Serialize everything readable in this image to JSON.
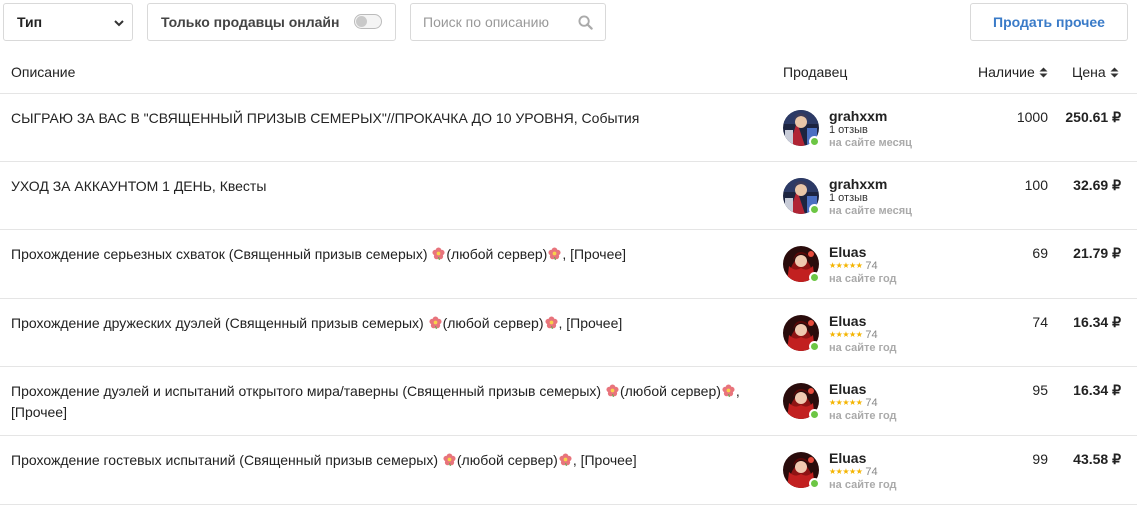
{
  "filters": {
    "type_label": "Тип",
    "online_label": "Только продавцы онлайн",
    "online_enabled": false,
    "search_placeholder": "Поиск по описанию",
    "search_value": "",
    "sell_label": "Продать прочее"
  },
  "table": {
    "headers": {
      "description": "Описание",
      "seller": "Продавец",
      "availability": "Наличие",
      "price": "Цена"
    },
    "rows": [
      {
        "desc_parts": [
          "СЫГРАЮ ЗА ВАС В \"СВЯЩЕННЫЙ ПРИЗЫВ СЕМЕРЫХ\"//ПРОКАЧКА ДО 10 УРОВНЯ, События"
        ],
        "seller": "grahxxm",
        "reviews": "1 отзыв",
        "stars": "",
        "rating_count": "",
        "since": "на сайте месяц",
        "availability": "1000",
        "price": "250.61 ₽"
      },
      {
        "desc_parts": [
          "УХОД ЗА АККАУНТОМ 1 ДЕНЬ, Квесты"
        ],
        "seller": "grahxxm",
        "reviews": "1 отзыв",
        "stars": "",
        "rating_count": "",
        "since": "на сайте месяц",
        "availability": "100",
        "price": "32.69 ₽"
      },
      {
        "desc_parts": [
          "Прохождение серьезных схваток (Священный призыв семерых) ",
          "(любой сервер)",
          ", [Прочее]"
        ],
        "seller": "Eluas",
        "reviews": "",
        "stars": "★★★★★",
        "rating_count": "74",
        "since": "на сайте год",
        "availability": "69",
        "price": "21.79 ₽"
      },
      {
        "desc_parts": [
          "Прохождение дружеских дуэлей (Священный призыв семерых) ",
          "(любой сервер)",
          ", [Прочее]"
        ],
        "seller": "Eluas",
        "reviews": "",
        "stars": "★★★★★",
        "rating_count": "74",
        "since": "на сайте год",
        "availability": "74",
        "price": "16.34 ₽"
      },
      {
        "desc_parts": [
          "Прохождение дуэлей и испытаний открытого мира/таверны (Священный призыв семерых) ",
          "(любой сервер)",
          ", [Прочее]"
        ],
        "seller": "Eluas",
        "reviews": "",
        "stars": "★★★★★",
        "rating_count": "74",
        "since": "на сайте год",
        "availability": "95",
        "price": "16.34 ₽"
      },
      {
        "desc_parts": [
          "Прохождение гостевых испытаний (Священный призыв семерых) ",
          "(любой сервер)",
          ", [Прочее]"
        ],
        "seller": "Eluas",
        "reviews": "",
        "stars": "★★★★★",
        "rating_count": "74",
        "since": "на сайте год",
        "availability": "99",
        "price": "43.58 ₽"
      }
    ]
  },
  "icons": {
    "type_select": "chevron-down-icon",
    "search": "search-icon",
    "sort": "sort-icon",
    "flower": "flower-emoji-icon",
    "online_status": "online-dot-icon"
  },
  "colors": {
    "accent": "#3a7bc8",
    "online": "#6cc644",
    "star": "#f4b400",
    "border": "#e5e5e5"
  }
}
